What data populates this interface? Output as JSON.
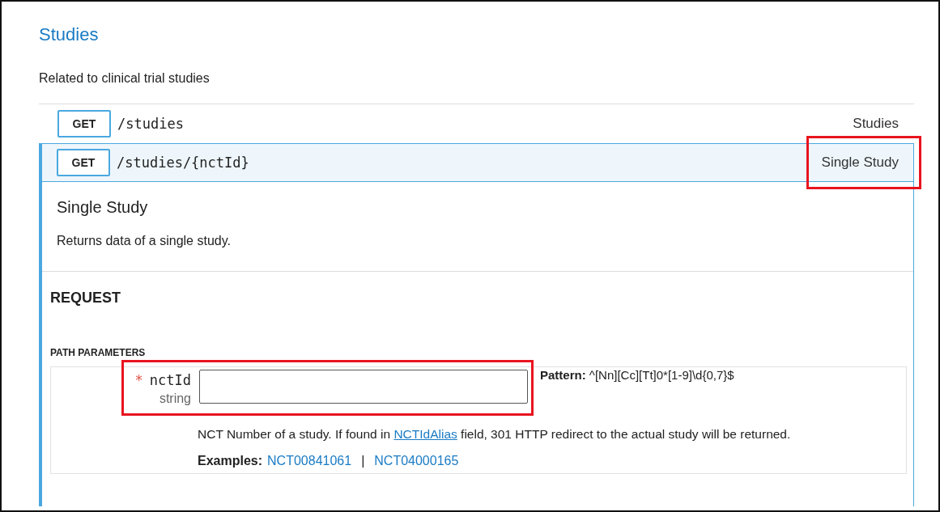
{
  "section": {
    "title": "Studies",
    "description": "Related to clinical trial studies"
  },
  "endpoints": [
    {
      "method": "GET",
      "path": "/studies",
      "summary": "Studies",
      "expanded": false,
      "highlighted": false
    },
    {
      "method": "GET",
      "path": "/studies/{nctId}",
      "summary": "Single Study",
      "expanded": true,
      "highlighted": true,
      "detail": {
        "title": "Single Study",
        "description": "Returns data of a single study.",
        "request_heading": "REQUEST",
        "params_heading": "PATH PARAMETERS",
        "params": [
          {
            "required": true,
            "required_mark": "*",
            "name": "nctId",
            "type": "string",
            "highlighted": true,
            "pattern_label": "Pattern:",
            "pattern": "^[Nn][Cc][Tt]0*[1-9]\\d{0,7}$",
            "description_before": "NCT Number of a study. If found in ",
            "description_link": "NCTIdAlias",
            "description_after": " field, 301 HTTP redirect to the actual study will be returned.",
            "examples_label": "Examples:",
            "examples": [
              "NCT00841061",
              "NCT04000165"
            ],
            "examples_separator": "|"
          }
        ]
      }
    }
  ]
}
